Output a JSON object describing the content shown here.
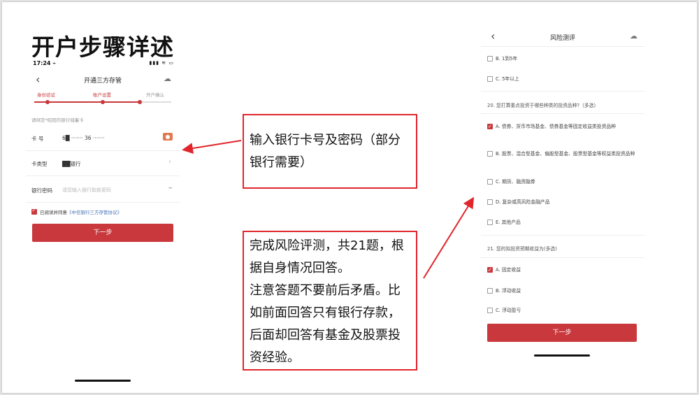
{
  "slide": {
    "title": "开户步骤详述"
  },
  "left_phone": {
    "status_time": "17:24 ⌁",
    "status_icons": "▮▮▮ ≋ ▭",
    "nav_back": "‹",
    "title": "开通三方存管",
    "nav_right_icon": "☁",
    "steps": [
      "身份验证",
      "账户设置",
      "开户确认"
    ],
    "hint": "请绑定*昭阳的银行储蓄卡",
    "card_label": "卡  号",
    "card_value": "6█ ·······  36 ·······",
    "card_type_label": "卡类型",
    "card_type_value": "██银行",
    "password_label": "银行密码",
    "password_placeholder": "请您输入银行取款密码",
    "agree_text": "已阅读并同意",
    "agree_link": "《中信银行三方存管协议》",
    "next_button": "下一步"
  },
  "notes": {
    "top": "输入银行卡号及密码（部分银行需要）",
    "bottom_lines": [
      "完成风险评测，共21题，根",
      "据自身情况回答。",
      "注意答题不要前后矛盾。比",
      "如前面回答只有银行存款，",
      "后面却回答有基金及股票投",
      "资经验。"
    ]
  },
  "right_phone": {
    "nav_back": "‹",
    "title": "风险测评",
    "nav_right_icon": "☁",
    "q19_options": [
      {
        "label": "B. 1到5年",
        "checked": false
      },
      {
        "label": "C. 5年以上",
        "checked": false
      }
    ],
    "q20": "20. 您打算重点投资于哪些种类的投资品种?（多选）",
    "q20_options": [
      {
        "label": "A. 债券、货币市场基金、债券基金等固定收益类投资品种",
        "checked": true
      },
      {
        "label": "B. 股票、混合型基金、偏股型基金、股票型基金等权益类投资品种",
        "checked": false
      },
      {
        "label": "C. 期货、融资融券",
        "checked": false
      },
      {
        "label": "D. 复杂或高风险金融产品",
        "checked": false
      },
      {
        "label": "E. 其他产品",
        "checked": false
      }
    ],
    "q21": "21. 您的拟投资预期收益为(多选)",
    "q21_options": [
      {
        "label": "A. 固定收益",
        "checked": true
      },
      {
        "label": "B. 浮动收益",
        "checked": false
      },
      {
        "label": "C. 浮动盈亏",
        "checked": false
      }
    ],
    "next_button": "下一步"
  },
  "colors": {
    "accent": "#c9383c",
    "annotation": "#e0262c",
    "link": "#3f6fb5"
  }
}
